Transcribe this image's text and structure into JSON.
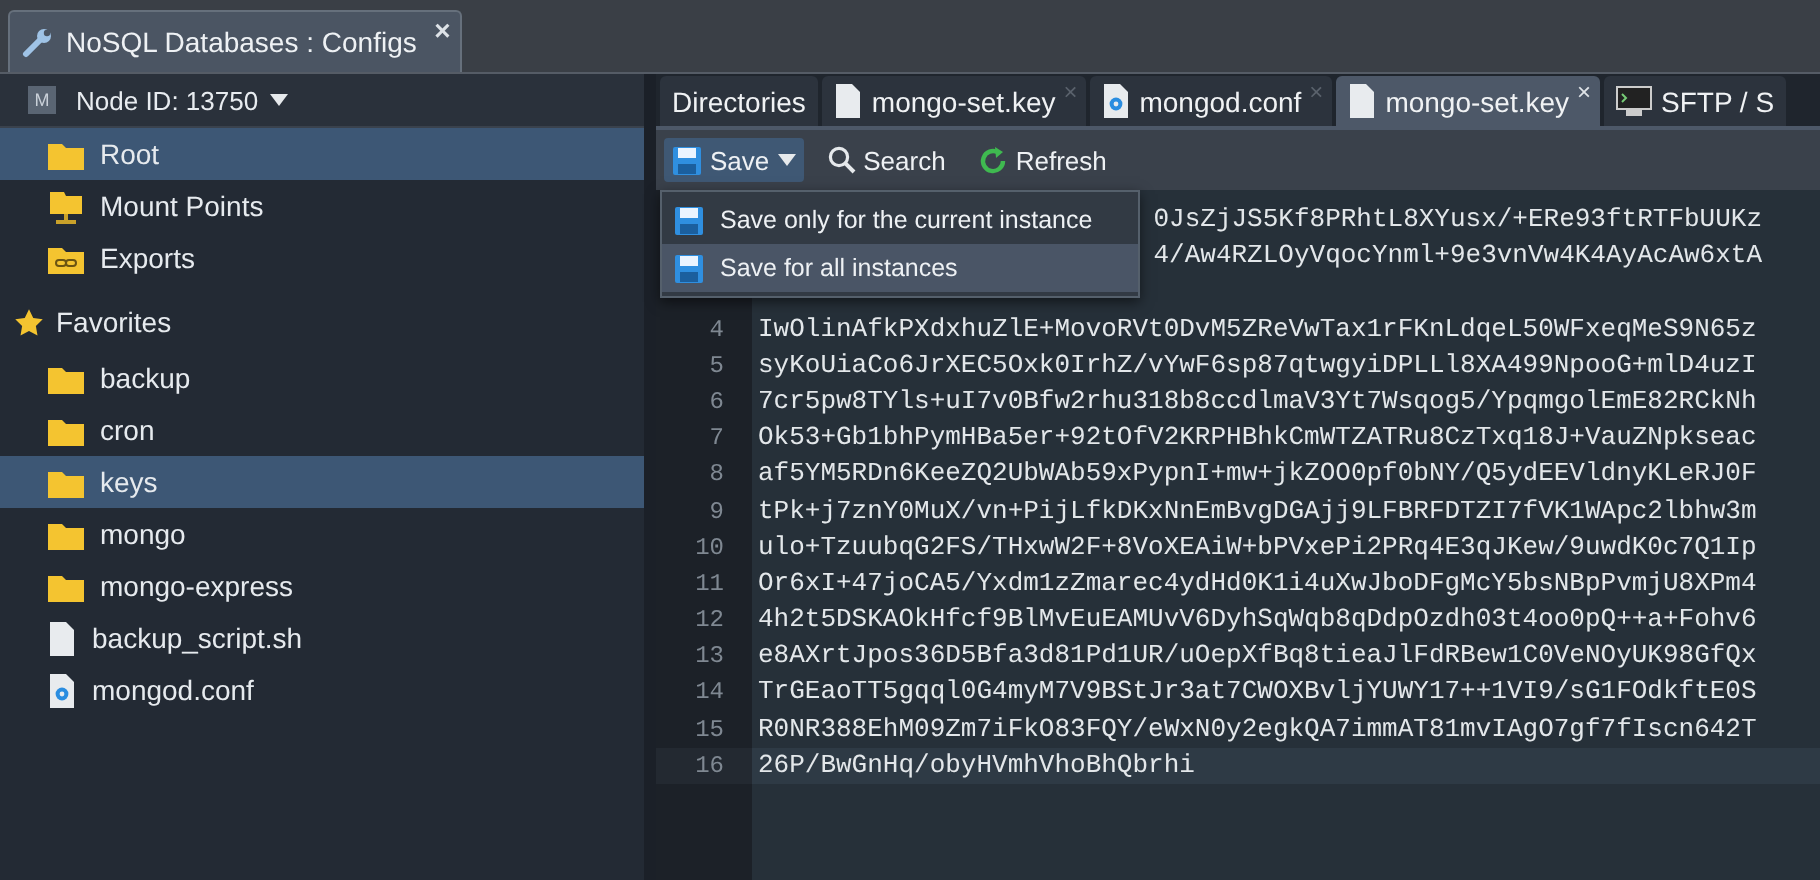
{
  "window_tab": {
    "title": "NoSQL Databases : Configs",
    "close": "×"
  },
  "node": {
    "badge": "M",
    "label": "Node ID: 13750"
  },
  "tree": [
    {
      "label": "Root",
      "kind": "folder",
      "selected": true
    },
    {
      "label": "Mount Points",
      "kind": "mount",
      "selected": false
    },
    {
      "label": "Exports",
      "kind": "export",
      "selected": false
    }
  ],
  "favorites": {
    "label": "Favorites",
    "items": [
      {
        "label": "backup",
        "kind": "folder",
        "selected": false
      },
      {
        "label": "cron",
        "kind": "folder",
        "selected": false
      },
      {
        "label": "keys",
        "kind": "folder",
        "selected": true
      },
      {
        "label": "mongo",
        "kind": "folder",
        "selected": false
      },
      {
        "label": "mongo-express",
        "kind": "folder",
        "selected": false
      },
      {
        "label": "backup_script.sh",
        "kind": "file",
        "selected": false
      },
      {
        "label": "mongod.conf",
        "kind": "config",
        "selected": false
      }
    ]
  },
  "tabs": [
    {
      "label": "Directories",
      "kind": "plain",
      "selected": false,
      "closable": false
    },
    {
      "label": "mongo-set.key",
      "kind": "file",
      "selected": false,
      "closable": true
    },
    {
      "label": "mongod.conf",
      "kind": "config",
      "selected": false,
      "closable": true
    },
    {
      "label": "mongo-set.key",
      "kind": "file",
      "selected": true,
      "closable": true
    },
    {
      "label": "SFTP / S",
      "kind": "terminal",
      "selected": false,
      "closable": false
    }
  ],
  "toolbar": [
    {
      "label": "Save",
      "kind": "save"
    },
    {
      "label": "Search",
      "kind": "search"
    },
    {
      "label": "Refresh",
      "kind": "refresh"
    }
  ],
  "save_menu": [
    {
      "label": "Save only for the current instance",
      "selected": false
    },
    {
      "label": "Save for all instances",
      "selected": true
    }
  ],
  "editor": {
    "lines_under_menu": [
      "0JsZjJS5Kf8PRhtL8XYusx/+ERe93ftRTFbUUKz",
      "4/Aw4RZLOyVqocYnml+9e3vnVw4K4AyAcAw6xtA"
    ],
    "lines": [
      {
        "number": "4",
        "text": "IwOlinAfkPXdxhuZlE+MovoRVt0DvM5ZReVwTax1rFKnLdqeL50WFxeqMeS9N65z",
        "current": false
      },
      {
        "number": "5",
        "text": "syKoUiaCo6JrXEC5Oxk0IrhZ/vYwF6sp87qtwgyiDPLLl8XA499NpooG+mlD4uzI",
        "current": false
      },
      {
        "number": "6",
        "text": "7cr5pw8TYls+uI7v0Bfw2rhu318b8ccdlmaV3Yt7Wsqog5/YpqmgolEmE82RCkNh",
        "current": false
      },
      {
        "number": "7",
        "text": "Ok53+Gb1bhPymHBa5er+92tOfV2KRPHBhkCmWTZATRu8CzTxq18J+VauZNpkseac",
        "current": false
      },
      {
        "number": "8",
        "text": "af5YM5RDn6KeeZQ2UbWAb59xPypnI+mw+jkZOO0pf0bNY/Q5ydEEVldnyKLeRJ0F",
        "current": false
      },
      {
        "number": "9",
        "text": "tPk+j7znY0MuX/vn+PijLfkDKxNnEmBvgDGAjj9LFBRFDTZI7fVK1WApc2lbhw3m",
        "current": false
      },
      {
        "number": "10",
        "text": "ulo+TzuubqG2FS/THxwW2F+8VoXEAiW+bPVxePi2PRq4E3qJKew/9uwdK0c7Q1Ip",
        "current": false
      },
      {
        "number": "11",
        "text": "Or6xI+47joCA5/Yxdm1zZmarec4ydHd0K1i4uXwJboDFgMcY5bsNBpPvmjU8XPm4",
        "current": false
      },
      {
        "number": "12",
        "text": "4h2t5DSKAOkHfcf9BlMvEuEAMUvV6DyhSqWqb8qDdpOzdh03t4oo0pQ++a+Fohv6",
        "current": false
      },
      {
        "number": "13",
        "text": "e8AXrtJpos36D5Bfa3d81Pd1UR/uOepXfBq8tieaJlFdRBew1C0VeNOyUK98GfQx",
        "current": false
      },
      {
        "number": "14",
        "text": "TrGEaoTT5gqql0G4myM7V9BStJr3at7CWOXBvljYUWY17++1VI9/sG1FOdkftE0S",
        "current": false
      },
      {
        "number": "15",
        "text": "R0NR388EhM09Zm7iFkO83FQY/eWxN0y2egkQA7immAT81mvIAgO7gf7fIscn642T",
        "current": false
      },
      {
        "number": "16",
        "text": "26P/BwGnHq/obyHVmhVhoBhQbrhi",
        "current": true
      }
    ]
  }
}
